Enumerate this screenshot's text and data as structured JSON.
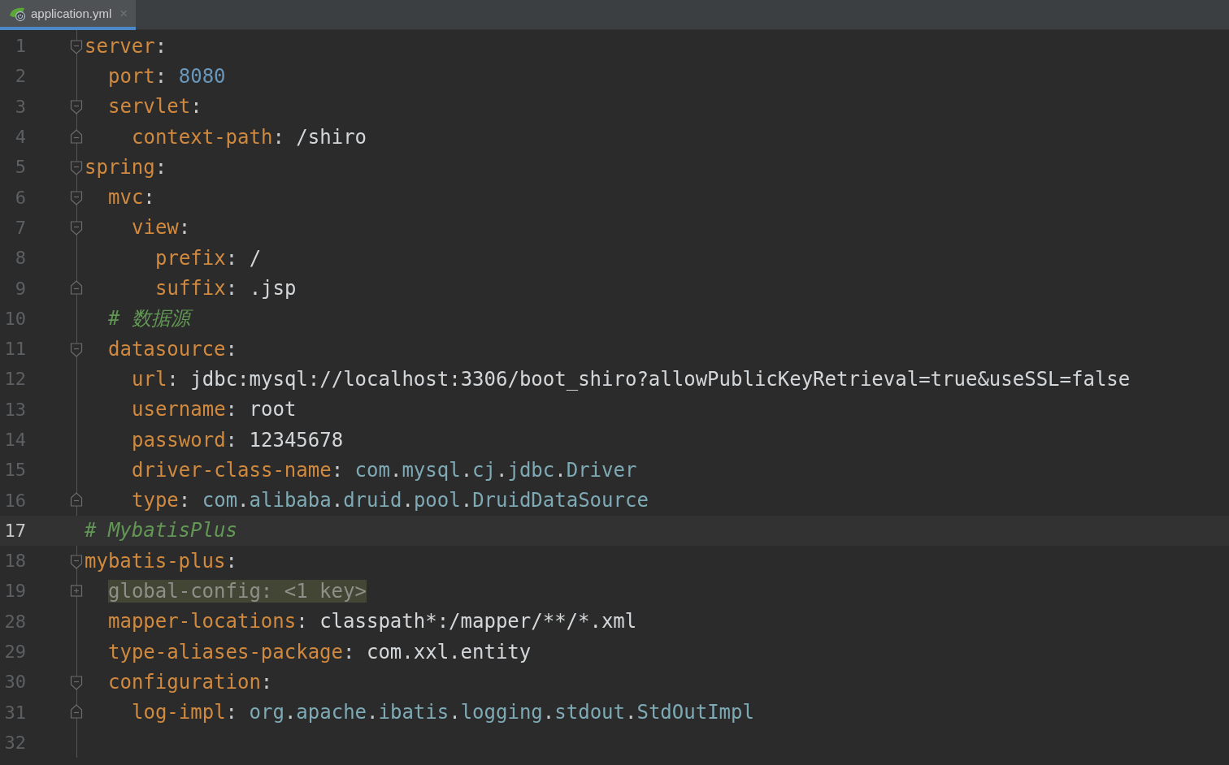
{
  "tabs": [
    {
      "label": "application.yml",
      "selected": true,
      "close": "×"
    }
  ],
  "lines": [
    {
      "number": "1",
      "current": false,
      "marker": {
        "kind": "start"
      },
      "kind": "entry",
      "key": "server",
      "colon": ":",
      "children": [
        {
          "number": "2",
          "current": false,
          "kind": "entry",
          "key": "port",
          "colon": ":",
          "value": {
            "kind": "number",
            "text": "8080"
          }
        },
        {
          "number": "3",
          "current": false,
          "marker": {
            "kind": "start"
          },
          "kind": "entry",
          "key": "servlet",
          "colon": ":",
          "children": [
            {
              "number": "4",
              "current": false,
              "marker": {
                "kind": "end"
              },
              "kind": "entry",
              "key": "context-path",
              "colon": ":",
              "value": {
                "kind": "plain",
                "text": "/shiro"
              }
            }
          ]
        }
      ]
    },
    {
      "number": "5",
      "current": false,
      "marker": {
        "kind": "start"
      },
      "kind": "entry",
      "key": "spring",
      "colon": ":",
      "children": [
        {
          "number": "6",
          "current": false,
          "marker": {
            "kind": "start"
          },
          "kind": "entry",
          "key": "mvc",
          "colon": ":",
          "children": [
            {
              "number": "7",
              "current": false,
              "marker": {
                "kind": "start"
              },
              "kind": "entry",
              "key": "view",
              "colon": ":",
              "children": [
                {
                  "number": "8",
                  "current": false,
                  "kind": "entry",
                  "key": "prefix",
                  "colon": ":",
                  "value": {
                    "kind": "plain",
                    "text": "/"
                  }
                },
                {
                  "number": "9",
                  "current": false,
                  "marker": {
                    "kind": "end"
                  },
                  "kind": "entry",
                  "key": "suffix",
                  "colon": ":",
                  "value": {
                    "kind": "plain",
                    "text": ".jsp"
                  }
                }
              ]
            }
          ]
        },
        {
          "number": "10",
          "current": false,
          "kind": "comment",
          "text": "# 数据源"
        },
        {
          "number": "11",
          "current": false,
          "marker": {
            "kind": "start"
          },
          "kind": "entry",
          "key": "datasource",
          "colon": ":",
          "children": [
            {
              "number": "12",
              "current": false,
              "kind": "entry",
              "key": "url",
              "colon": ":",
              "value": {
                "kind": "plain",
                "text": "jdbc:mysql://localhost:3306/boot_shiro?allowPublicKeyRetrieval=true&useSSL=false"
              }
            },
            {
              "number": "13",
              "current": false,
              "kind": "entry",
              "key": "username",
              "colon": ":",
              "value": {
                "kind": "plain",
                "text": "root"
              }
            },
            {
              "number": "14",
              "current": false,
              "kind": "entry",
              "key": "password",
              "colon": ":",
              "value": {
                "kind": "plain",
                "text": "12345678"
              }
            },
            {
              "number": "15",
              "current": false,
              "kind": "entry",
              "key": "driver-class-name",
              "colon": ":",
              "value": {
                "kind": "class",
                "text": "com.mysql.cj.jdbc.Driver"
              }
            },
            {
              "number": "16",
              "current": false,
              "marker": {
                "kind": "end"
              },
              "kind": "entry",
              "key": "type",
              "colon": ":",
              "value": {
                "kind": "class",
                "text": "com.alibaba.druid.pool.DruidDataSource"
              }
            }
          ]
        }
      ]
    },
    {
      "number": "17",
      "current": true,
      "kind": "comment",
      "text": "# MybatisPlus"
    },
    {
      "number": "18",
      "current": false,
      "marker": {
        "kind": "start"
      },
      "kind": "entry",
      "key": "mybatis-plus",
      "colon": ":",
      "children": [
        {
          "number": "19",
          "current": false,
          "marker": {
            "kind": "collapsed"
          },
          "kind": "folded",
          "text": "global-config: <1 key>"
        },
        {
          "number": "28",
          "current": false,
          "kind": "entry",
          "key": "mapper-locations",
          "colon": ":",
          "value": {
            "kind": "plain",
            "text": "classpath*:/mapper/**/*.xml"
          }
        },
        {
          "number": "29",
          "current": false,
          "kind": "entry",
          "key": "type-aliases-package",
          "colon": ":",
          "value": {
            "kind": "plain",
            "text": "com.xxl.entity"
          }
        },
        {
          "number": "30",
          "current": false,
          "marker": {
            "kind": "start"
          },
          "kind": "entry",
          "key": "configuration",
          "colon": ":",
          "children": [
            {
              "number": "31",
              "current": false,
              "marker": {
                "kind": "end"
              },
              "kind": "entry",
              "key": "log-impl",
              "colon": ":",
              "value": {
                "kind": "class",
                "text": "org.apache.ibatis.logging.stdout.StdOutImpl"
              }
            }
          ]
        }
      ]
    },
    {
      "number": "32",
      "current": false,
      "kind": "blank"
    }
  ]
}
